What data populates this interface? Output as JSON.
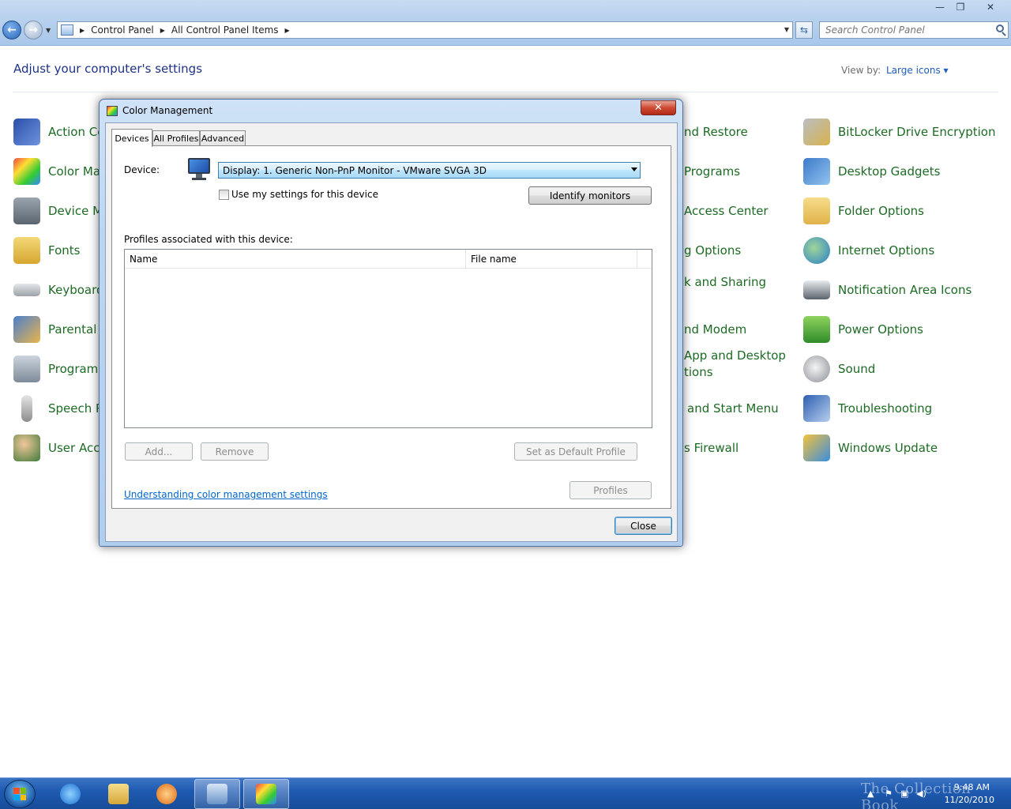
{
  "window": {
    "minimize_glyph": "—",
    "restore_glyph": "❐",
    "close_glyph": "✕"
  },
  "address": {
    "crumbs": [
      "Control Panel",
      "All Control Panel Items"
    ],
    "search_placeholder": "Search Control Panel"
  },
  "content": {
    "heading": "Adjust your computer's settings",
    "view_by_label": "View by:",
    "view_by_value": "Large icons ▾"
  },
  "items_left": [
    {
      "label": "Action Ce",
      "icon": "action-center-flag-icon"
    },
    {
      "label": "Color Ma",
      "icon": "color-management-icon"
    },
    {
      "label": "Device M",
      "icon": "device-manager-icon"
    },
    {
      "label": "Fonts",
      "icon": "fonts-icon"
    },
    {
      "label": "Keyboard",
      "icon": "keyboard-icon"
    },
    {
      "label": "Parental",
      "icon": "parental-controls-icon"
    },
    {
      "label": "Programs",
      "icon": "programs-icon"
    },
    {
      "label": "Speech R",
      "icon": "microphone-icon"
    },
    {
      "label": "User Acc",
      "icon": "user-accounts-icon"
    }
  ],
  "items_middle": [
    {
      "label": "nd Restore"
    },
    {
      "label": "Programs"
    },
    {
      "label": "Access Center"
    },
    {
      "label": "g Options"
    },
    {
      "label": "k and Sharing"
    },
    {
      "label": "nd Modem"
    },
    {
      "label": "App and Desktop",
      "label2": "tions"
    },
    {
      "label": "and Start Menu"
    },
    {
      "label": "s Firewall"
    }
  ],
  "items_right": [
    {
      "label": "BitLocker Drive Encryption",
      "icon": "bitlocker-key-icon"
    },
    {
      "label": "Desktop Gadgets",
      "icon": "desktop-gadgets-icon"
    },
    {
      "label": "Folder Options",
      "icon": "folder-options-icon"
    },
    {
      "label": "Internet Options",
      "icon": "internet-options-globe-icon"
    },
    {
      "label": "Notification Area Icons",
      "icon": "notification-area-icon"
    },
    {
      "label": "Power Options",
      "icon": "power-options-battery-icon"
    },
    {
      "label": "Sound",
      "icon": "sound-speaker-icon"
    },
    {
      "label": "Troubleshooting",
      "icon": "troubleshooting-icon"
    },
    {
      "label": "Windows Update",
      "icon": "windows-update-icon"
    }
  ],
  "dialog": {
    "title": "Color Management",
    "close_glyph": "✕",
    "tabs": [
      "Devices",
      "All Profiles",
      "Advanced"
    ],
    "device_label": "Device:",
    "device_value": "Display: 1. Generic Non-PnP Monitor - VMware SVGA 3D",
    "use_settings_label": "Use my settings for this device",
    "identify_button": "Identify monitors",
    "profiles_label": "Profiles associated with this device:",
    "columns": [
      "Name",
      "File name"
    ],
    "add_button": "Add...",
    "remove_button": "Remove",
    "set_default_button": "Set as Default Profile",
    "link": "Understanding color management settings",
    "profiles_button": "Profiles",
    "close_button": "Close"
  },
  "taskbar": {
    "time": "9:48 AM",
    "date": "11/20/2010",
    "watermark": "The Collection Book"
  }
}
